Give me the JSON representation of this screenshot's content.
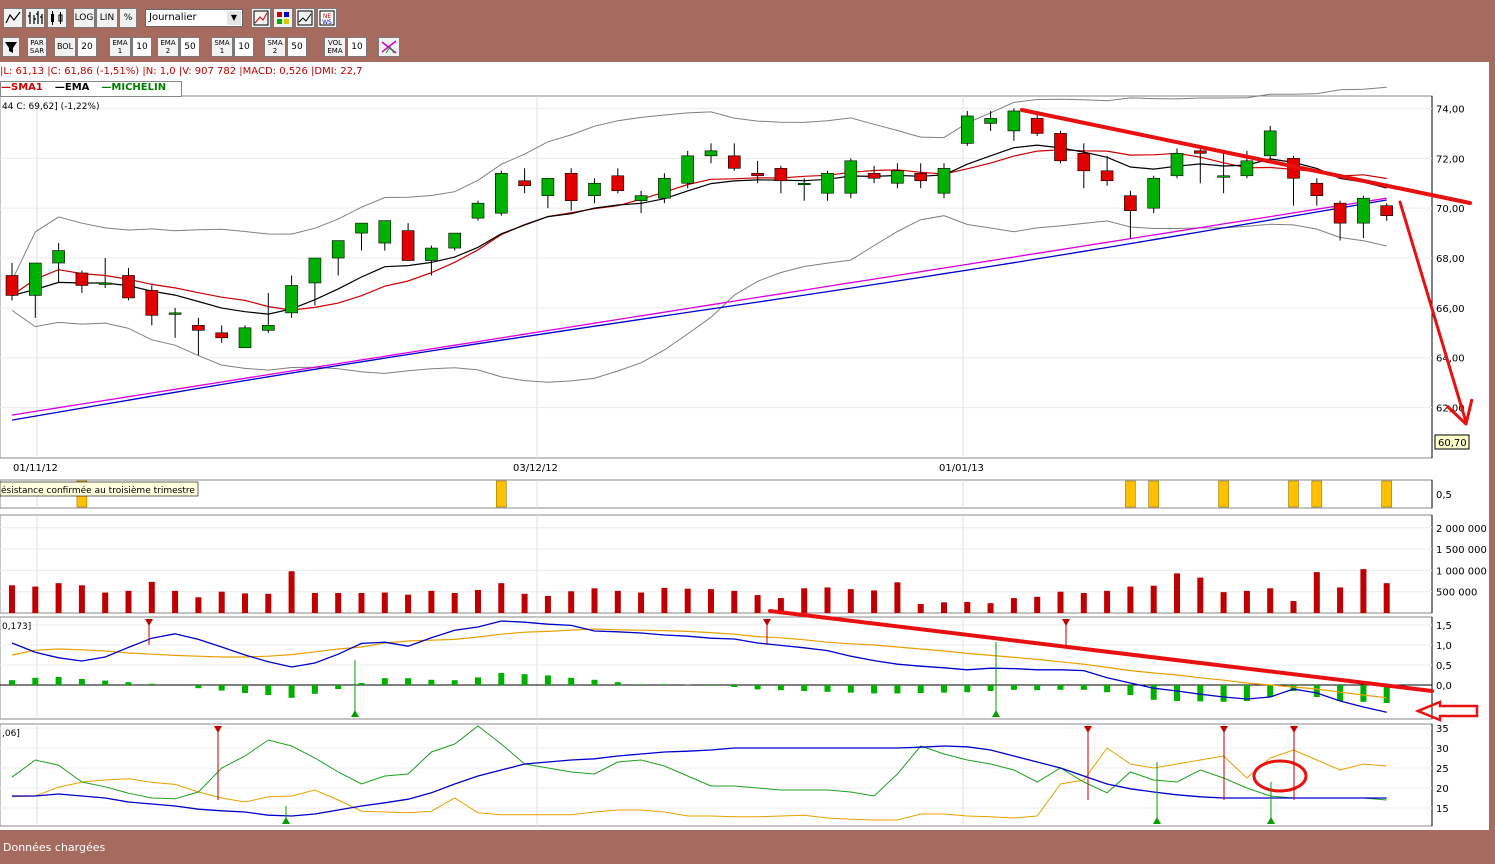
{
  "toolbar1": {
    "log_label": "LOG",
    "lin_label": "LIN",
    "pct_label": "%",
    "period_select": "Journalier"
  },
  "toolbar2": {
    "parsar_label": "PAR SAR",
    "bol_label": "BOL",
    "bol_value": "20",
    "ema1_label": "EMA 1",
    "ema1_value": "10",
    "ema2_label": "EMA 2",
    "ema2_value": "50",
    "sma1_label": "SMA 1",
    "sma1_value": "10",
    "sma2_label": "SMA 2",
    "sma2_value": "50",
    "volema_label": "VOL EMA",
    "volema_value": "10"
  },
  "info_line": "|L: 61,13 |C: 61,86 (-1,51%) |N: 1,0 |V: 907 782 |MACD: 0,526 |DMI: 22,7",
  "legend": {
    "sma": "SMA1",
    "ema": "EMA",
    "michelin": "MICHELIN"
  },
  "price_caption": "44  C: 69,62] (-1,22%)",
  "last_price_tag": "60,70",
  "event_note": "ésistance confirmée au troisième trimestre",
  "macd_caption": "0,173]",
  "dmi_caption": ",06]",
  "status": "Données chargées",
  "colors": {
    "up": "#00b000",
    "down": "#e00000",
    "sma": "#cc0000",
    "ema": "#000000",
    "ma50_blue": "#0000cc",
    "ma50_magenta": "#dd00dd",
    "boll": "#808080",
    "annot": "#e81010",
    "event": "#ffc000"
  },
  "chart_data": [
    {
      "type": "candlestick",
      "title": "MICHELIN",
      "x_ticks": [
        "01/11/12",
        "03/12/12",
        "01/01/13"
      ],
      "y_ticks": [
        "62,00",
        "64,00",
        "66,00",
        "68,00",
        "70,00",
        "72,00",
        "74,00"
      ],
      "ylim": [
        60.7,
        74.5
      ],
      "candles": [
        {
          "o": 67.3,
          "h": 67.8,
          "l": 66.3,
          "c": 66.5
        },
        {
          "o": 66.5,
          "h": 67.8,
          "l": 65.6,
          "c": 67.8
        },
        {
          "o": 67.8,
          "h": 68.6,
          "l": 67.0,
          "c": 68.3
        },
        {
          "o": 67.4,
          "h": 67.5,
          "l": 66.6,
          "c": 66.9
        },
        {
          "o": 67.0,
          "h": 68.0,
          "l": 66.8,
          "c": 67.0
        },
        {
          "o": 67.3,
          "h": 67.6,
          "l": 66.3,
          "c": 66.4
        },
        {
          "o": 66.7,
          "h": 66.9,
          "l": 65.3,
          "c": 65.7
        },
        {
          "o": 65.8,
          "h": 66.0,
          "l": 64.8,
          "c": 65.8
        },
        {
          "o": 65.3,
          "h": 65.6,
          "l": 64.1,
          "c": 65.1
        },
        {
          "o": 65.0,
          "h": 65.3,
          "l": 64.6,
          "c": 64.8
        },
        {
          "o": 64.4,
          "h": 65.3,
          "l": 64.4,
          "c": 65.2
        },
        {
          "o": 65.1,
          "h": 66.6,
          "l": 65.0,
          "c": 65.3
        },
        {
          "o": 65.8,
          "h": 67.3,
          "l": 65.6,
          "c": 66.9
        },
        {
          "o": 67.0,
          "h": 67.5,
          "l": 66.1,
          "c": 68.0
        },
        {
          "o": 68.0,
          "h": 68.5,
          "l": 67.3,
          "c": 68.7
        },
        {
          "o": 69.0,
          "h": 69.1,
          "l": 68.3,
          "c": 69.4
        },
        {
          "o": 68.6,
          "h": 69.5,
          "l": 68.3,
          "c": 69.5
        },
        {
          "o": 69.1,
          "h": 69.4,
          "l": 67.9,
          "c": 67.9
        },
        {
          "o": 67.9,
          "h": 68.5,
          "l": 67.3,
          "c": 68.4
        },
        {
          "o": 68.4,
          "h": 69.0,
          "l": 68.3,
          "c": 69.0
        },
        {
          "o": 69.6,
          "h": 70.3,
          "l": 69.5,
          "c": 70.2
        },
        {
          "o": 69.8,
          "h": 71.5,
          "l": 69.7,
          "c": 71.4
        },
        {
          "o": 71.1,
          "h": 71.6,
          "l": 70.6,
          "c": 70.9
        },
        {
          "o": 70.5,
          "h": 71.2,
          "l": 70.0,
          "c": 71.2
        },
        {
          "o": 71.4,
          "h": 71.6,
          "l": 69.9,
          "c": 70.3
        },
        {
          "o": 70.5,
          "h": 71.2,
          "l": 70.2,
          "c": 71.0
        },
        {
          "o": 71.3,
          "h": 71.6,
          "l": 70.6,
          "c": 70.7
        },
        {
          "o": 70.3,
          "h": 70.7,
          "l": 69.8,
          "c": 70.5
        },
        {
          "o": 70.4,
          "h": 71.4,
          "l": 70.2,
          "c": 71.2
        },
        {
          "o": 71.0,
          "h": 72.3,
          "l": 70.8,
          "c": 72.1
        },
        {
          "o": 72.1,
          "h": 72.6,
          "l": 71.8,
          "c": 72.3
        },
        {
          "o": 72.1,
          "h": 72.6,
          "l": 71.5,
          "c": 71.6
        },
        {
          "o": 71.4,
          "h": 71.9,
          "l": 71.0,
          "c": 71.3
        },
        {
          "o": 71.6,
          "h": 71.7,
          "l": 70.6,
          "c": 71.1
        },
        {
          "o": 71.0,
          "h": 71.2,
          "l": 70.3,
          "c": 71.0
        },
        {
          "o": 70.6,
          "h": 71.5,
          "l": 70.3,
          "c": 71.4
        },
        {
          "o": 70.6,
          "h": 72.0,
          "l": 70.4,
          "c": 71.9
        },
        {
          "o": 71.4,
          "h": 71.7,
          "l": 71.0,
          "c": 71.2
        },
        {
          "o": 71.0,
          "h": 71.8,
          "l": 70.8,
          "c": 71.5
        },
        {
          "o": 71.4,
          "h": 71.8,
          "l": 70.8,
          "c": 71.1
        },
        {
          "o": 70.6,
          "h": 71.8,
          "l": 70.4,
          "c": 71.6
        },
        {
          "o": 72.6,
          "h": 73.9,
          "l": 72.5,
          "c": 73.7
        },
        {
          "o": 73.4,
          "h": 73.9,
          "l": 73.1,
          "c": 73.6
        },
        {
          "o": 73.1,
          "h": 74.0,
          "l": 72.7,
          "c": 73.9
        },
        {
          "o": 73.6,
          "h": 73.8,
          "l": 72.9,
          "c": 73.0
        },
        {
          "o": 73.0,
          "h": 73.1,
          "l": 71.8,
          "c": 71.9
        },
        {
          "o": 72.2,
          "h": 72.6,
          "l": 70.8,
          "c": 71.5
        },
        {
          "o": 71.5,
          "h": 72.1,
          "l": 70.9,
          "c": 71.1
        },
        {
          "o": 70.5,
          "h": 70.7,
          "l": 68.8,
          "c": 69.9
        },
        {
          "o": 70.0,
          "h": 71.3,
          "l": 69.8,
          "c": 71.2
        },
        {
          "o": 71.3,
          "h": 72.4,
          "l": 71.2,
          "c": 72.2
        },
        {
          "o": 72.3,
          "h": 72.5,
          "l": 71.0,
          "c": 72.2
        },
        {
          "o": 71.3,
          "h": 72.3,
          "l": 70.6,
          "c": 71.3
        },
        {
          "o": 71.3,
          "h": 72.3,
          "l": 71.2,
          "c": 71.9
        },
        {
          "o": 72.1,
          "h": 73.3,
          "l": 72.0,
          "c": 73.1
        },
        {
          "o": 72.0,
          "h": 72.1,
          "l": 70.1,
          "c": 71.2
        },
        {
          "o": 71.0,
          "h": 71.2,
          "l": 70.1,
          "c": 70.5
        },
        {
          "o": 70.2,
          "h": 70.3,
          "l": 68.7,
          "c": 69.4
        },
        {
          "o": 69.4,
          "h": 70.5,
          "l": 68.8,
          "c": 70.4
        },
        {
          "o": 70.1,
          "h": 70.2,
          "l": 69.5,
          "c": 69.7
        }
      ],
      "annotation": "downward trend line and arrow drawn in red"
    },
    {
      "type": "event_markers",
      "y_ticks": [
        "0,5"
      ],
      "events_at_candle": [
        3,
        21,
        48,
        49,
        52,
        55,
        56,
        59
      ]
    },
    {
      "type": "bar",
      "title": "Volume",
      "y_ticks": [
        "500 000",
        "1 000 000",
        "1 500 000",
        "2 000 000"
      ],
      "ylim": [
        0,
        2300000
      ],
      "values": [
        650000,
        620000,
        700000,
        650000,
        480000,
        520000,
        730000,
        520000,
        370000,
        500000,
        460000,
        450000,
        980000,
        470000,
        470000,
        470000,
        480000,
        430000,
        520000,
        470000,
        540000,
        700000,
        450000,
        400000,
        510000,
        580000,
        520000,
        480000,
        590000,
        570000,
        560000,
        520000,
        420000,
        350000,
        580000,
        600000,
        560000,
        530000,
        720000,
        210000,
        250000,
        260000,
        230000,
        350000,
        380000,
        500000,
        470000,
        520000,
        620000,
        640000,
        930000,
        830000,
        490000,
        520000,
        580000,
        280000,
        960000,
        600000,
        1030000,
        700000,
        560000
      ]
    },
    {
      "type": "line+bar",
      "title": "MACD",
      "y_ticks": [
        "0,0",
        "0,5",
        "1,0",
        "1,5"
      ],
      "ylim": [
        -0.8,
        1.65
      ],
      "macd": [
        1.05,
        0.82,
        0.68,
        0.6,
        0.7,
        0.94,
        1.17,
        1.28,
        1.14,
        0.95,
        0.75,
        0.58,
        0.45,
        0.55,
        0.77,
        1.04,
        1.07,
        0.97,
        1.18,
        1.37,
        1.45,
        1.6,
        1.57,
        1.52,
        1.49,
        1.35,
        1.33,
        1.3,
        1.25,
        1.22,
        1.17,
        1.15,
        1.05,
        0.99,
        0.93,
        0.86,
        0.72,
        0.61,
        0.52,
        0.47,
        0.43,
        0.38,
        0.42,
        0.41,
        0.38,
        0.38,
        0.36,
        0.18,
        0.05,
        -0.08,
        -0.15,
        -0.23,
        -0.3,
        -0.35,
        -0.3,
        -0.1,
        -0.2,
        -0.4,
        -0.55,
        -0.68
      ],
      "signal": [
        0.75,
        0.87,
        0.9,
        0.88,
        0.85,
        0.8,
        0.77,
        0.74,
        0.72,
        0.7,
        0.7,
        0.72,
        0.76,
        0.83,
        0.9,
        0.95,
        1.05,
        1.1,
        1.12,
        1.14,
        1.2,
        1.27,
        1.32,
        1.34,
        1.37,
        1.4,
        1.38,
        1.37,
        1.36,
        1.34,
        1.31,
        1.27,
        1.21,
        1.18,
        1.13,
        1.07,
        1.03,
        1.0,
        0.95,
        0.9,
        0.85,
        0.79,
        0.74,
        0.69,
        0.64,
        0.58,
        0.52,
        0.44,
        0.36,
        0.3,
        0.25,
        0.18,
        0.12,
        0.05,
        0.0,
        -0.05,
        -0.1,
        -0.18,
        -0.25,
        -0.32
      ],
      "histogram": [
        0.12,
        0.18,
        0.2,
        0.15,
        0.11,
        0.07,
        0.03,
        0.0,
        -0.08,
        -0.14,
        -0.2,
        -0.25,
        -0.32,
        -0.22,
        -0.1,
        0.05,
        0.17,
        0.17,
        0.13,
        0.12,
        0.19,
        0.3,
        0.27,
        0.24,
        0.18,
        0.13,
        0.07,
        0.02,
        0.02,
        0.01,
        -0.02,
        -0.05,
        -0.11,
        -0.13,
        -0.15,
        -0.17,
        -0.19,
        -0.21,
        -0.21,
        -0.2,
        -0.19,
        -0.18,
        -0.15,
        -0.12,
        -0.13,
        -0.12,
        -0.12,
        -0.18,
        -0.25,
        -0.37,
        -0.4,
        -0.41,
        -0.42,
        -0.4,
        -0.3,
        -0.15,
        -0.3,
        -0.4,
        -0.42,
        -0.45
      ]
    },
    {
      "type": "line",
      "title": "DMI",
      "y_ticks": [
        "15",
        "20",
        "25",
        "30",
        "35"
      ],
      "ylim": [
        10.5,
        36
      ],
      "adx": [
        18,
        18,
        18.5,
        18,
        17.5,
        16.5,
        16,
        15.5,
        14.7,
        14.3,
        14,
        13.2,
        13,
        13.5,
        14.5,
        15.5,
        16.3,
        17.2,
        18.8,
        21,
        23,
        24.5,
        26,
        26.5,
        27,
        27.3,
        28,
        28.5,
        29,
        29.2,
        29.5,
        30,
        30,
        30,
        30,
        30,
        30,
        30,
        30,
        30.2,
        30.5,
        30.3,
        29.5,
        28,
        26.5,
        25,
        23,
        21,
        19.8,
        19,
        18.3,
        17.8,
        17.5,
        17.5,
        17.5,
        17.5,
        17.5,
        17.5,
        17.5,
        17.5
      ],
      "di_plus": [
        22.7,
        27,
        25.7,
        21.5,
        20.3,
        18.7,
        17.5,
        17.3,
        19,
        25,
        28,
        32,
        30.5,
        27.5,
        24,
        21,
        23,
        23.5,
        29,
        31,
        35.5,
        31,
        26,
        25,
        24,
        23.5,
        26.5,
        27,
        25.5,
        23,
        20.5,
        20.5,
        20,
        19.5,
        19.5,
        19.5,
        19,
        18,
        23.5,
        30.5,
        28.5,
        27,
        26,
        24.5,
        21.5,
        25,
        21.5,
        18.8,
        24,
        22,
        21.5,
        24.5,
        22.5,
        20,
        18,
        17.5,
        17.5,
        17.5,
        17.5,
        17
      ],
      "di_minus": [
        17.8,
        18,
        20.2,
        21.5,
        22,
        22.3,
        21.4,
        20.9,
        19,
        17.5,
        16.5,
        17.8,
        18,
        19.5,
        17,
        14.2,
        14,
        13.8,
        14.2,
        17.5,
        13.8,
        13.3,
        13.3,
        13.3,
        13.3,
        14,
        14.5,
        14.5,
        14,
        13,
        13,
        12.8,
        12.8,
        13,
        13.2,
        12.5,
        12.2,
        12,
        12,
        13.5,
        13.5,
        13,
        12.8,
        12.5,
        13,
        21,
        22,
        30,
        26,
        25,
        26,
        27,
        28,
        22.5,
        27.5,
        29.5,
        27,
        24.5,
        26,
        25.5
      ]
    }
  ]
}
